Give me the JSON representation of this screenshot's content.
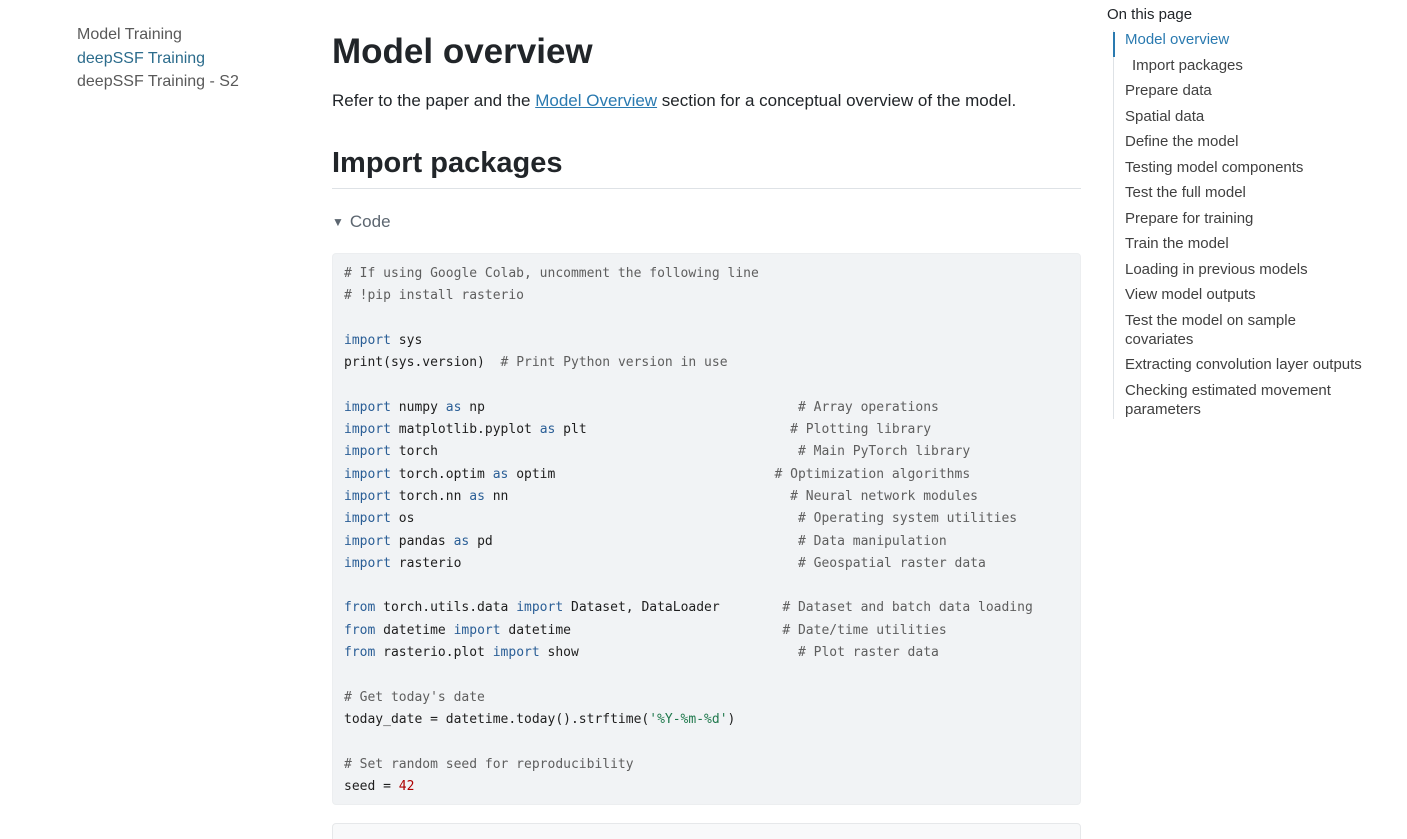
{
  "left_nav": {
    "items": [
      {
        "label": "Model Training"
      },
      {
        "label": "deepSSF Training"
      },
      {
        "label": "deepSSF Training - S2"
      }
    ]
  },
  "main": {
    "title": "Model overview",
    "intro": {
      "before": "Refer to the paper and the ",
      "link": "Model Overview",
      "after": " section for a conceptual overview of the model."
    },
    "section_title": "Import packages",
    "code_toggle": "Code"
  },
  "code": [
    [
      {
        "c": "cm",
        "t": "# If using Google Colab, uncomment the following line"
      }
    ],
    [
      {
        "c": "cm",
        "t": "# !pip install rasterio"
      }
    ],
    [],
    [
      {
        "c": "kw",
        "t": "import"
      },
      {
        "t": " sys"
      }
    ],
    [
      {
        "t": "print(sys.version)  "
      },
      {
        "c": "cm",
        "t": "# Print Python version in use"
      }
    ],
    [],
    [
      {
        "c": "kw",
        "t": "import"
      },
      {
        "t": " numpy "
      },
      {
        "c": "kw",
        "t": "as"
      },
      {
        "t": " np                                        "
      },
      {
        "c": "cm",
        "t": "# Array operations"
      }
    ],
    [
      {
        "c": "kw",
        "t": "import"
      },
      {
        "t": " matplotlib.pyplot "
      },
      {
        "c": "kw",
        "t": "as"
      },
      {
        "t": " plt                          "
      },
      {
        "c": "cm",
        "t": "# Plotting library"
      }
    ],
    [
      {
        "c": "kw",
        "t": "import"
      },
      {
        "t": " torch                                              "
      },
      {
        "c": "cm",
        "t": "# Main PyTorch library"
      }
    ],
    [
      {
        "c": "kw",
        "t": "import"
      },
      {
        "t": " torch.optim "
      },
      {
        "c": "kw",
        "t": "as"
      },
      {
        "t": " optim                            "
      },
      {
        "c": "cm",
        "t": "# Optimization algorithms"
      }
    ],
    [
      {
        "c": "kw",
        "t": "import"
      },
      {
        "t": " torch.nn "
      },
      {
        "c": "kw",
        "t": "as"
      },
      {
        "t": " nn                                   "
      },
      {
        "c": "cm",
        "t": " # Neural network modules"
      }
    ],
    [
      {
        "c": "kw",
        "t": "import"
      },
      {
        "t": " os                                                 "
      },
      {
        "c": "cm",
        "t": "# Operating system utilities"
      }
    ],
    [
      {
        "c": "kw",
        "t": "import"
      },
      {
        "t": " pandas "
      },
      {
        "c": "kw",
        "t": "as"
      },
      {
        "t": " pd                                       "
      },
      {
        "c": "cm",
        "t": "# Data manipulation"
      }
    ],
    [
      {
        "c": "kw",
        "t": "import"
      },
      {
        "t": " rasterio                                           "
      },
      {
        "c": "cm",
        "t": "# Geospatial raster data"
      }
    ],
    [],
    [
      {
        "c": "kw",
        "t": "from"
      },
      {
        "t": " torch.utils.data "
      },
      {
        "c": "kw",
        "t": "import"
      },
      {
        "t": " Dataset, DataLoader        "
      },
      {
        "c": "cm",
        "t": "# Dataset and batch data loading"
      }
    ],
    [
      {
        "c": "kw",
        "t": "from"
      },
      {
        "t": " datetime "
      },
      {
        "c": "kw",
        "t": "import"
      },
      {
        "t": " datetime                           "
      },
      {
        "c": "cm",
        "t": "# Date/time utilities"
      }
    ],
    [
      {
        "c": "kw",
        "t": "from"
      },
      {
        "t": " rasterio.plot "
      },
      {
        "c": "kw",
        "t": "import"
      },
      {
        "t": " show                           "
      },
      {
        "c": "cm",
        "t": " # Plot raster data"
      }
    ],
    [],
    [
      {
        "c": "cm",
        "t": "# Get today's date"
      }
    ],
    [
      {
        "t": "today_date = datetime.today().strftime("
      },
      {
        "c": "st",
        "t": "'%Y-%m-%d'"
      },
      {
        "t": ")"
      }
    ],
    [],
    [
      {
        "c": "cm",
        "t": "# Set random seed for reproducibility"
      }
    ],
    [
      {
        "t": "seed = "
      },
      {
        "c": "nm",
        "t": "42"
      }
    ]
  ],
  "toc": {
    "title": "On this page",
    "items": [
      {
        "label": "Model overview"
      },
      {
        "label": "Import packages"
      },
      {
        "label": "Prepare data"
      },
      {
        "label": "Spatial data"
      },
      {
        "label": "Define the model"
      },
      {
        "label": "Testing model components"
      },
      {
        "label": "Test the full model"
      },
      {
        "label": "Prepare for training"
      },
      {
        "label": "Train the model"
      },
      {
        "label": "Loading in previous models"
      },
      {
        "label": "View model outputs"
      },
      {
        "label": "Test the model on sample covariates"
      },
      {
        "label": "Extracting convolution layer outputs"
      },
      {
        "label": "Checking estimated movement parameters"
      }
    ]
  }
}
